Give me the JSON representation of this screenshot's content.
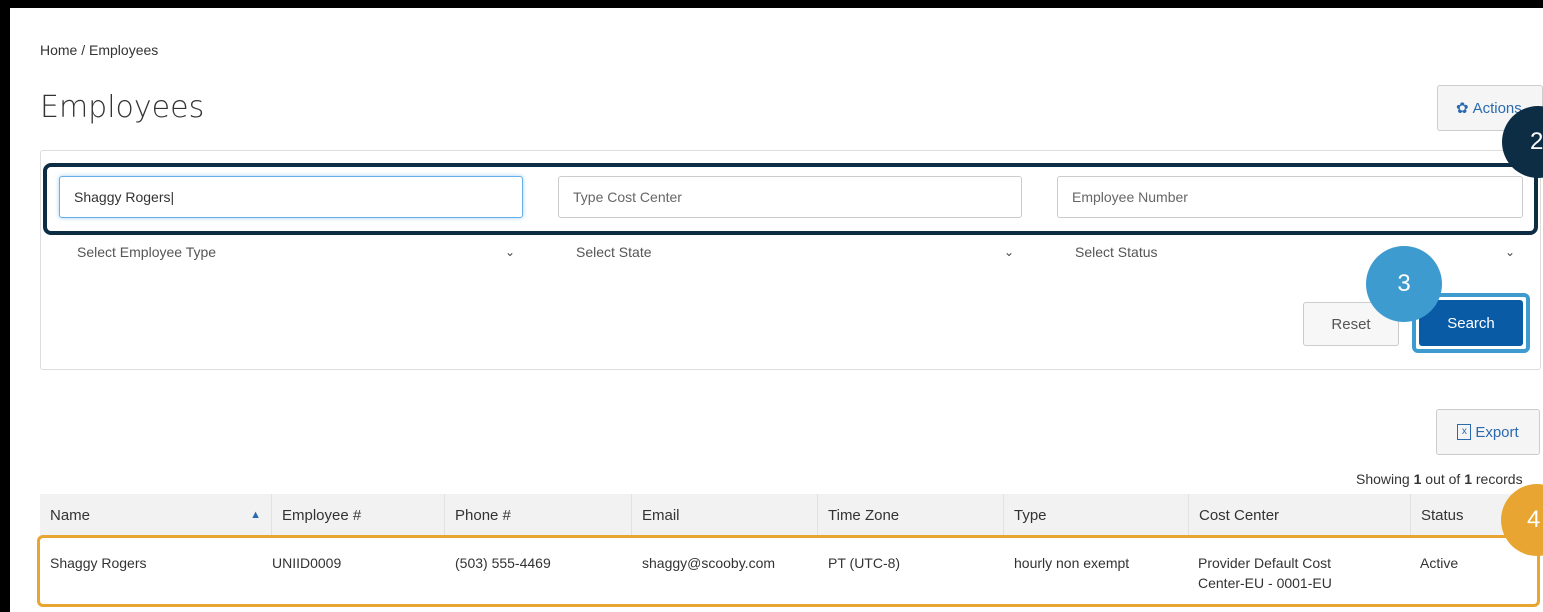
{
  "breadcrumb": "Home / Employees",
  "page_title": "Employees",
  "actions_label": "Actions",
  "filters": {
    "name_value": "Shaggy Rogers",
    "cost_center_placeholder": "Type Cost Center",
    "employee_number_placeholder": "Employee Number",
    "employee_type_selected": "Select Employee Type",
    "state_selected": "Select State",
    "status_selected": "Select Status"
  },
  "buttons": {
    "reset": "Reset",
    "search": "Search",
    "export": "Export"
  },
  "badges": {
    "two": "2",
    "three": "3",
    "four": "4"
  },
  "results_summary": {
    "prefix": "Showing ",
    "shown": "1",
    "middle": " out of ",
    "total": "1",
    "suffix": " records"
  },
  "table": {
    "headers": [
      "Name",
      "Employee #",
      "Phone #",
      "Email",
      "Time Zone",
      "Type",
      "Cost Center",
      "Status"
    ],
    "rows": [
      {
        "name": "Shaggy Rogers",
        "employee_number": "UNIID0009",
        "phone": "(503) 555-4469",
        "email": "shaggy@scooby.com",
        "time_zone": "PT (UTC-8)",
        "type": "hourly non exempt",
        "cost_center": "Provider Default Cost Center-EU - 0001-EU",
        "status": "Active"
      }
    ]
  },
  "colors": {
    "primary": "#0a5ba6",
    "highlight_dark": "#0c2d44",
    "highlight_blue": "#3d9bd0",
    "highlight_orange": "#e8a531"
  }
}
